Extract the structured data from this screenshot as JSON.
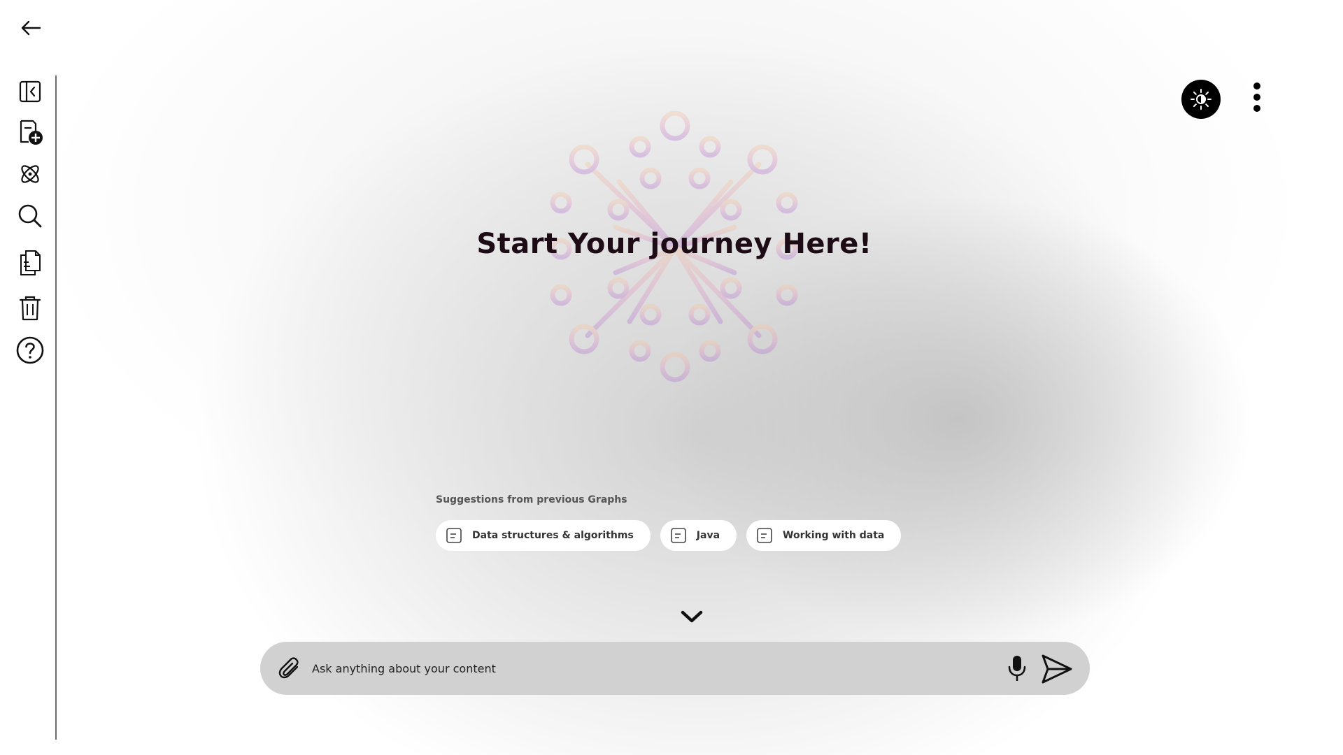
{
  "app": {
    "hero_title": "Start Your journey Here!"
  },
  "sidebar": {
    "items": [
      {
        "name": "collapse-sidebar",
        "icon": "panel-collapse-icon"
      },
      {
        "name": "new-document",
        "icon": "file-plus-icon"
      },
      {
        "name": "graph",
        "icon": "atom-icon"
      },
      {
        "name": "search",
        "icon": "search-icon"
      },
      {
        "name": "documents",
        "icon": "documents-icon"
      },
      {
        "name": "trash",
        "icon": "trash-icon"
      },
      {
        "name": "help",
        "icon": "help-circle-icon"
      }
    ]
  },
  "suggestions": {
    "label": "Suggestions from previous Graphs",
    "chips": [
      {
        "label": "Data structures & algorithms",
        "icon": "document-icon"
      },
      {
        "label": "Java",
        "icon": "document-icon"
      },
      {
        "label": "Working with data",
        "icon": "document-icon"
      }
    ]
  },
  "composer": {
    "placeholder": "Ask anything about your content"
  },
  "colors": {
    "accent": "#000000",
    "composer_bg": "#d1d1d1",
    "title": "#1d0b16",
    "hero_gradient_start": "#f7c6a0",
    "hero_gradient_end": "#c79bd9"
  }
}
